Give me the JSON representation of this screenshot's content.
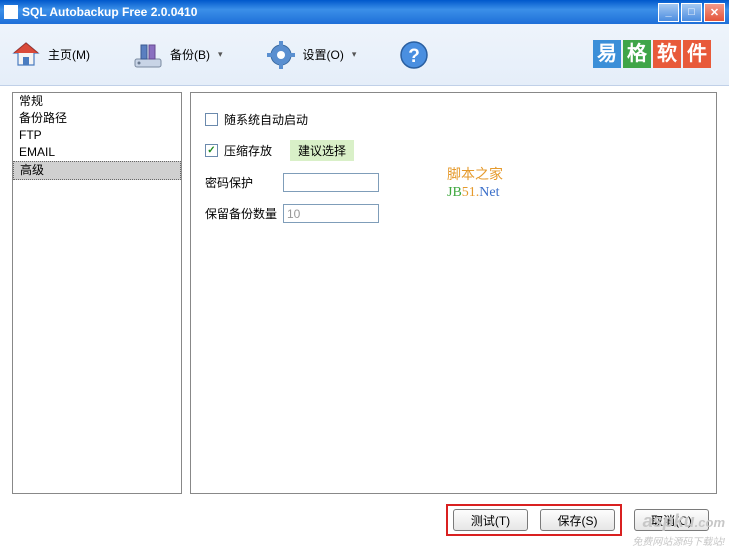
{
  "titlebar": {
    "title": "SQL Autobackup Free 2.0.0410"
  },
  "toolbar": {
    "home": "主页(M)",
    "backup": "备份(B)",
    "settings": "设置(O)"
  },
  "logo": {
    "char1": "易",
    "char2": "格",
    "char3": "软",
    "char4": "件"
  },
  "sidebar": {
    "items": [
      {
        "label": "常规"
      },
      {
        "label": "备份路径"
      },
      {
        "label": "FTP"
      },
      {
        "label": "EMAIL"
      },
      {
        "label": "高级"
      }
    ]
  },
  "form": {
    "autostart": {
      "label": "随系统自动启动",
      "checked": false
    },
    "compress": {
      "label": "压缩存放",
      "checked": true,
      "hint": "建议选择"
    },
    "password": {
      "label": "密码保护",
      "value": ""
    },
    "keepcount": {
      "label": "保留备份数量",
      "value": "10"
    }
  },
  "watermark": {
    "line1": "脚本之家",
    "line2_a": "JB",
    "line2_b": "51.",
    "line2_c": "Net"
  },
  "buttons": {
    "test": "测试(T)",
    "save": "保存(S)",
    "cancel": "取消(C)"
  },
  "footer": {
    "brand": "aspku",
    "tld": ".com",
    "tag": "免费网站源码下载站!"
  }
}
